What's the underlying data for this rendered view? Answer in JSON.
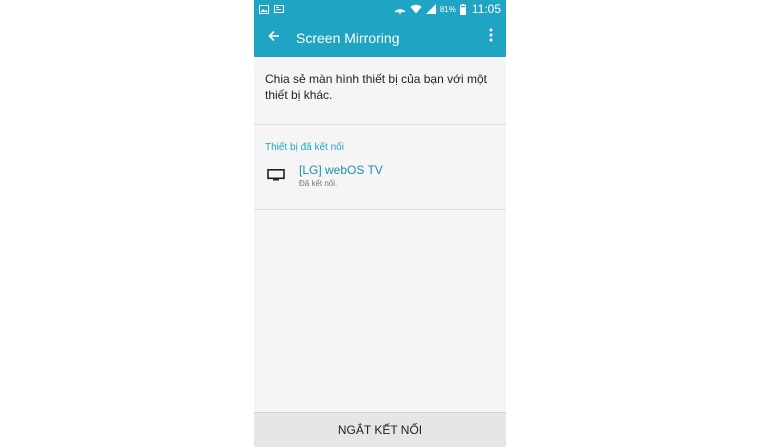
{
  "status_bar": {
    "battery_percent": "81%",
    "time": "11:05",
    "icons": [
      "image-icon",
      "notification-icon",
      "cast-icon",
      "wifi-icon",
      "signal-icon",
      "battery-icon"
    ]
  },
  "app_bar": {
    "title": "Screen Mirroring",
    "back_icon": "arrow-left-icon",
    "menu_icon": "more-vertical-icon"
  },
  "description": "Chia sẻ màn hình thiết bị của bạn với một thiết bị khác.",
  "section": {
    "title": "Thiết bị đã kết nối"
  },
  "devices": [
    {
      "name": "[LG] webOS TV",
      "status": "Đã kết nối.",
      "icon": "tv-icon"
    }
  ],
  "bottom_button": {
    "label": "NGẮT KẾT NỐI"
  },
  "colors": {
    "accent": "#1fa4c4",
    "background": "#f5f5f5",
    "bottom_bar": "#e6e6e6"
  }
}
